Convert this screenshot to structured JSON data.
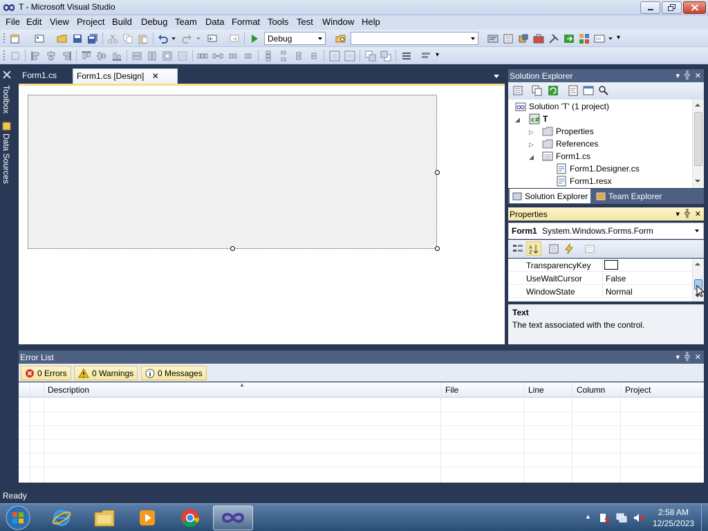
{
  "window": {
    "title": "T - Microsoft Visual Studio"
  },
  "menubar": {
    "items": [
      "File",
      "Edit",
      "View",
      "Project",
      "Build",
      "Debug",
      "Team",
      "Data",
      "Format",
      "Tools",
      "Test",
      "Window",
      "Help"
    ]
  },
  "toolbar": {
    "configuration": "Debug",
    "platform": ""
  },
  "left_strip": {
    "toolbox_label": "Toolbox",
    "data_sources_label": "Data Sources"
  },
  "document_tabs": [
    {
      "label": "Form1.cs",
      "active": false
    },
    {
      "label": "Form1.cs [Design]",
      "active": true,
      "close": "✕"
    }
  ],
  "solution_explorer": {
    "title": "Solution Explorer",
    "tree": {
      "solution": "Solution 'T' (1 project)",
      "project": "T",
      "properties": "Properties",
      "references": "References",
      "form": "Form1.cs",
      "designer": "Form1.Designer.cs",
      "resx": "Form1.resx"
    },
    "tabs": [
      "Solution Explorer",
      "Team Explorer"
    ]
  },
  "properties": {
    "title": "Properties",
    "object_name": "Form1",
    "object_type": "System.Windows.Forms.Form",
    "rows": [
      {
        "name": "TransparencyKey",
        "value": ""
      },
      {
        "name": "UseWaitCursor",
        "value": "False"
      },
      {
        "name": "WindowState",
        "value": "Normal"
      }
    ],
    "description_title": "Text",
    "description_text": "The text associated with the control."
  },
  "error_list": {
    "title": "Error List",
    "errors_label": "0 Errors",
    "warnings_label": "0 Warnings",
    "messages_label": "0 Messages",
    "columns": [
      "Description",
      "File",
      "Line",
      "Column",
      "Project"
    ]
  },
  "status": {
    "text": "Ready"
  },
  "taskbar": {
    "time": "2:58 AM",
    "date": "12/25/2023"
  },
  "colors": {
    "ide_background": "#293955",
    "active_title": "#f6e7a3",
    "inactive_title": "#4d6082"
  }
}
